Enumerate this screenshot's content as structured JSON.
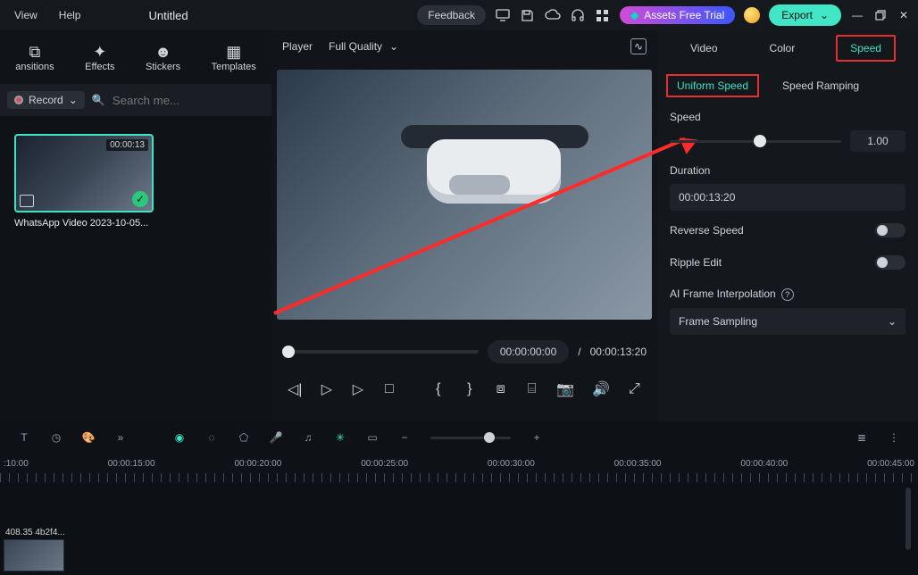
{
  "menu": {
    "view": "View",
    "help": "Help"
  },
  "title": "Untitled",
  "top": {
    "feedback": "Feedback",
    "trial": "Assets Free Trial",
    "export": "Export"
  },
  "left_tabs": {
    "transitions": "ansitions",
    "effects": "Effects",
    "stickers": "Stickers",
    "templates": "Templates"
  },
  "left_bar": {
    "record": "Record",
    "search_placeholder": "Search me..."
  },
  "clip": {
    "duration": "00:00:13",
    "name": "WhatsApp Video 2023-10-05..."
  },
  "player": {
    "label": "Player",
    "quality": "Full Quality",
    "time_current": "00:00:00:00",
    "time_sep": "/",
    "time_total": "00:00:13:20"
  },
  "right_tabs": {
    "video": "Video",
    "color": "Color",
    "speed": "Speed"
  },
  "speed": {
    "sub_uniform": "Uniform Speed",
    "sub_ramping": "Speed Ramping",
    "speed_label": "Speed",
    "speed_value": "1.00",
    "duration_label": "Duration",
    "duration_value": "00:00:13:20",
    "reverse_label": "Reverse Speed",
    "ripple_label": "Ripple Edit",
    "ai_label": "AI Frame Interpolation",
    "ai_value": "Frame Sampling"
  },
  "ruler": [
    ":10:00",
    "00:00:15:00",
    "00:00:20:00",
    "00:00:25:00",
    "00:00:30:00",
    "00:00:35:00",
    "00:00:40:00",
    "00:00:45:00"
  ],
  "track_clip_label": "408.35 4b2f4..."
}
